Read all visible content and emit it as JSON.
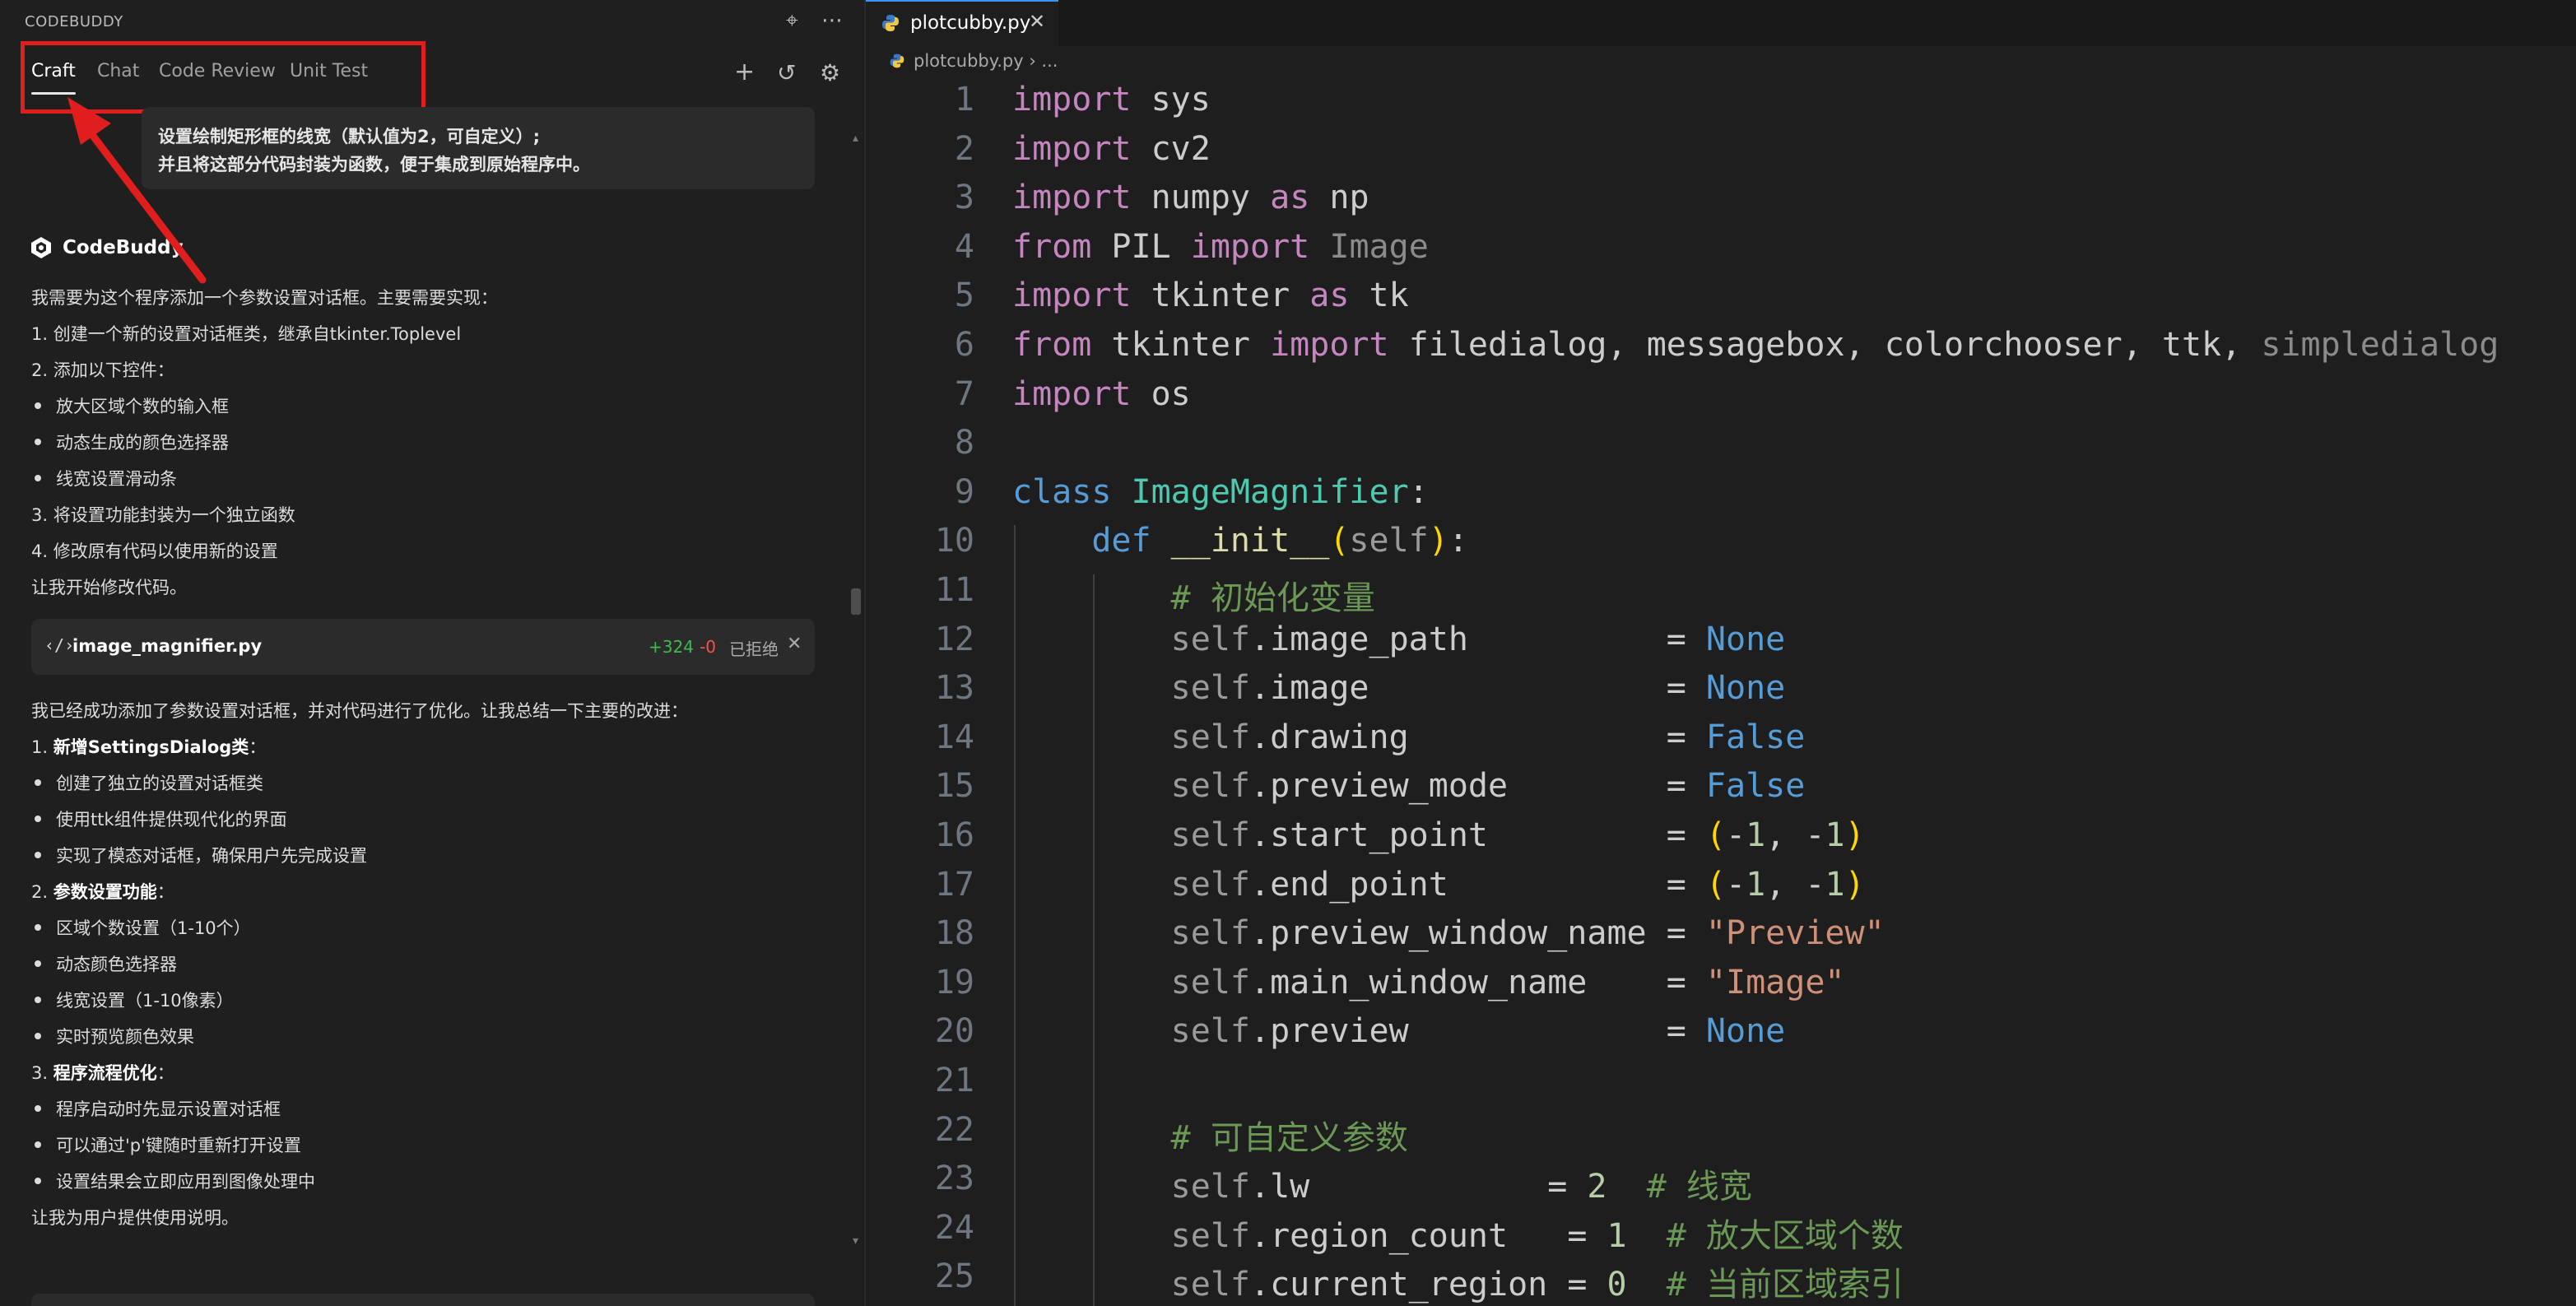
{
  "panel": {
    "title": "CODEBUDDY",
    "tabs": [
      "Craft",
      "Chat",
      "Code Review",
      "Unit Test"
    ],
    "active_tab": "Craft"
  },
  "user_message": [
    "设置绘制矩形框的线宽（默认值为2，可自定义）;",
    "并且将这部分代码封装为函数，便于集成到原始程序中。"
  ],
  "assistant": {
    "name": "CodeBuddy",
    "intro": "我需要为这个程序添加一个参数设置对话框。主要需要实现：",
    "step1": "1. 创建一个新的设置对话框类，继承自tkinter.Toplevel",
    "step2": "2. 添加以下控件：",
    "step2_bullets": [
      "放大区域个数的输入框",
      "动态生成的颜色选择器",
      "线宽设置滑动条"
    ],
    "step3": "3. 将设置功能封装为一个独立函数",
    "step4": "4. 修改原有代码以使用新的设置",
    "start": "让我开始修改代码。",
    "file_card": {
      "name": "image_magnifier.py",
      "additions": "+324",
      "deletions": "-0",
      "status": "已拒绝"
    },
    "summary": "我已经成功添加了参数设置对话框，并对代码进行了优化。让我总结一下主要的改进：",
    "s1_num": "1. ",
    "s1_title": "新增SettingsDialog类",
    "s1_bullets": [
      "创建了独立的设置对话框类",
      "使用ttk组件提供现代化的界面",
      "实现了模态对话框，确保用户先完成设置"
    ],
    "s2_num": "2. ",
    "s2_title": "参数设置功能",
    "s2_bullets": [
      "区域个数设置（1-10个）",
      "动态颜色选择器",
      "线宽设置（1-10像素）",
      "实时预览颜色效果"
    ],
    "s3_num": "3. ",
    "s3_title": "程序流程优化",
    "s3_bullets": [
      "程序启动时先显示设置对话框",
      "可以通过'p'键随时重新打开设置",
      "设置结果会立即应用到图像处理中"
    ],
    "outro": "让我为用户提供使用说明。"
  },
  "editor": {
    "tab_label": "plotcubby.py",
    "breadcrumb_file": "plotcubby.py",
    "breadcrumb_sep": "›",
    "breadcrumb_rest": "...",
    "line_numbers": [
      "1",
      "2",
      "3",
      "4",
      "5",
      "6",
      "7",
      "8",
      "9",
      "10",
      "11",
      "12",
      "13",
      "14",
      "15",
      "16",
      "17",
      "18",
      "19",
      "20",
      "21",
      "22",
      "23",
      "24",
      "25"
    ],
    "code_lines": [
      "import sys",
      "import cv2",
      "import numpy as np",
      "from PIL import Image",
      "import tkinter as tk",
      "from tkinter import filedialog, messagebox, colorchooser, ttk, simpledialog",
      "import os",
      "",
      "class ImageMagnifier:",
      "    def __init__(self):",
      "        # 初始化变量",
      "        self.image_path          = None",
      "        self.image               = None",
      "        self.drawing             = False",
      "        self.preview_mode        = False",
      "        self.start_point         = (-1, -1)",
      "        self.end_point           = (-1, -1)",
      "        self.preview_window_name = \"Preview\"",
      "        self.main_window_name    = \"Image\"",
      "        self.preview             = None",
      "",
      "        # 可自定义参数",
      "        self.lw            = 2  # 线宽",
      "        self.region_count   = 1  # 放大区域个数",
      "        self.current_region = 0  # 当前区域索引"
    ]
  },
  "colors": {
    "accent": "#3794ff",
    "annotation_red": "#e01e1e",
    "added": "#3fb950",
    "deleted": "#f85149"
  }
}
